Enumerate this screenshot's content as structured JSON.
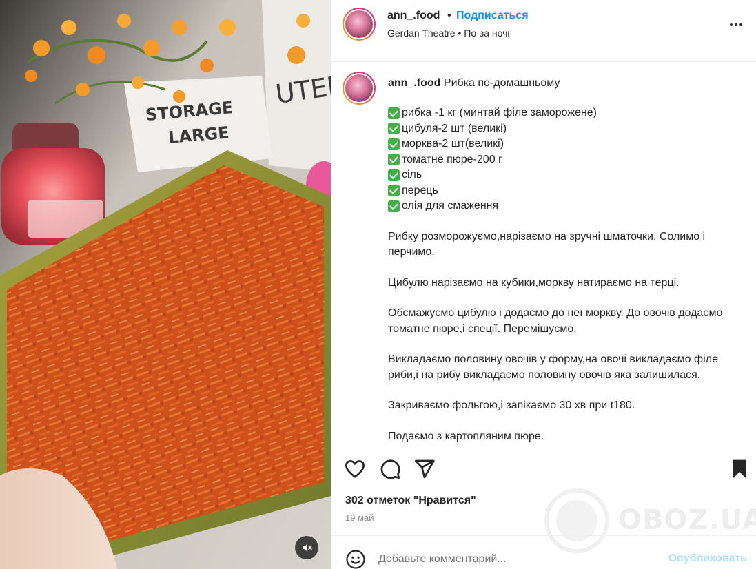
{
  "post": {
    "username": "ann_.food",
    "separator": "•",
    "follow_label": "Подписаться",
    "audio": "Gerdan Theatre • По-за ночі",
    "more_icon": "more-horizontal-icon"
  },
  "caption": {
    "username": "ann_.food",
    "title": "Рибка по-домашньому",
    "ingredients": [
      "рибка -1 кг (минтай філе заморожене)",
      "цибуля-2 шт (великі)",
      "морква-2 шт(великі)",
      "томатне пюре-200 г",
      "сіль",
      "перець",
      "олія для смаження"
    ],
    "paragraphs": [
      "Рибку розморожуємо,нарізаємо на зручні шматочки. Солимо і перчимо.",
      "Цибулю нарізаємо на кубики,моркву натираємо на терці.",
      "Обсмажуємо цибулю і додаємо до неї моркву. До овочів додаємо томатне пюре,і спеції. Перемішуємо.",
      "Викладаємо половину овочів у форму,на овочі викладаємо філе риби,і на рибу викладаємо половину овочів яка залишилася.",
      "Закриваємо фольгою,і запікаємо 30 хв при t180.",
      "Подаємо з картопляним пюре."
    ]
  },
  "stats": {
    "likes": "302 отметок \"Нравится\"",
    "date": "19 май"
  },
  "comment": {
    "placeholder": "Добавьте комментарий...",
    "publish_label": "Опубликовать"
  },
  "media": {
    "canister_front_text": "STORAGE\nLARGE",
    "canister_back_text": "UTENS",
    "mute_icon": "volume-off-icon"
  },
  "watermark": {
    "text": "OBOZ.UA"
  },
  "icons": {
    "like": "heart-icon",
    "comment": "comment-icon",
    "share": "paper-plane-icon",
    "save": "bookmark-icon",
    "emoji": "emoji-icon"
  },
  "colors": {
    "link": "#0095f6",
    "publish_disabled": "#b2dffc",
    "text": "#262626",
    "muted": "#8e8e8e",
    "check": "#43b047"
  }
}
